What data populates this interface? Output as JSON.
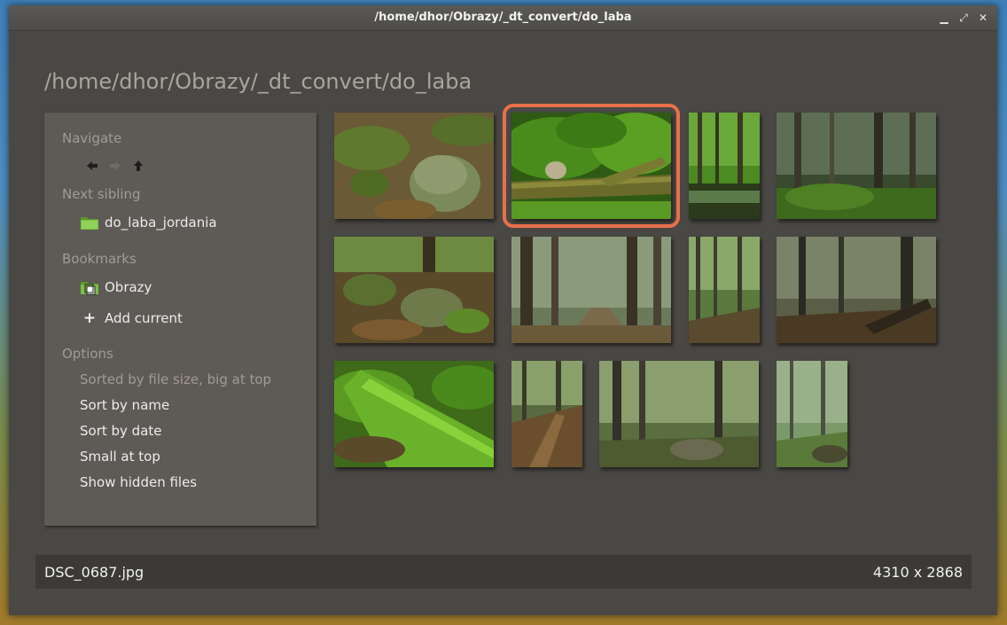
{
  "window": {
    "title": "/home/dhor/Obrazy/_dt_convert/do_laba",
    "controls": [
      "minimize-icon",
      "maximize-icon",
      "close-icon"
    ]
  },
  "heading": "/home/dhor/Obrazy/_dt_convert/do_laba",
  "sidebar": {
    "navigate_title": "Navigate",
    "nav_icons": [
      "back-arrow-icon",
      "forward-arrow-icon",
      "up-arrow-icon"
    ],
    "next_sibling_title": "Next sibling",
    "next_sibling": "do_laba_jordania",
    "bookmarks_title": "Bookmarks",
    "bookmark": "Obrazy",
    "add_current": "Add current",
    "options_title": "Options",
    "options": [
      "Sorted by file size, big at top",
      "Sort by name",
      "Sort by date",
      "Small at top",
      "Show hidden files"
    ]
  },
  "thumbnails": [
    {
      "scene": "mossy-rocks",
      "selected": false
    },
    {
      "scene": "fern-log",
      "selected": true
    },
    {
      "scene": "stream-trees",
      "selected": false
    },
    {
      "scene": "misty-forest",
      "selected": false
    },
    {
      "scene": "rocky-forest-floor",
      "selected": false
    },
    {
      "scene": "foggy-path",
      "selected": false
    },
    {
      "scene": "slope-trees",
      "selected": false
    },
    {
      "scene": "dark-forest-roots",
      "selected": false
    },
    {
      "scene": "green-moss-log",
      "selected": false
    },
    {
      "scene": "forest-trail",
      "selected": false
    },
    {
      "scene": "trees-rocks",
      "selected": false
    },
    {
      "scene": "fog-green",
      "selected": false
    }
  ],
  "status": {
    "filename": "DSC_0687.jpg",
    "dimensions": "4310 x 2868"
  },
  "colors": {
    "accent": "#e8704a",
    "window_bg": "#4a4844",
    "sidebar_bg": "#5e5a55",
    "dim_text": "#a09b93"
  }
}
